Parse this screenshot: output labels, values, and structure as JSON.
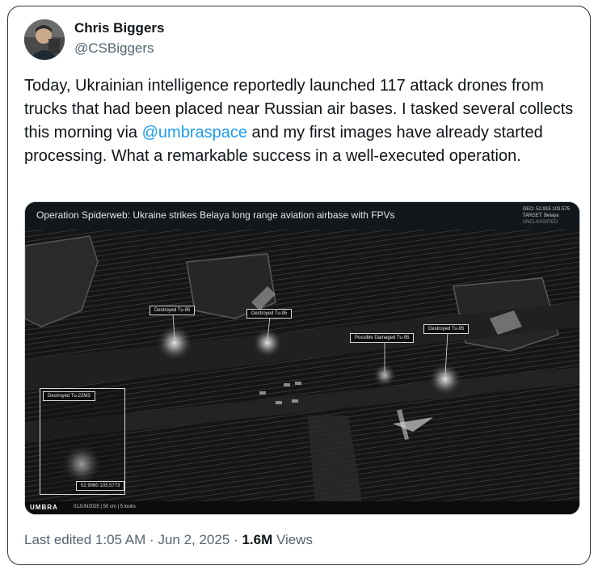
{
  "author": {
    "name": "Chris Biggers",
    "handle": "@CSBiggers"
  },
  "tweet": {
    "text_before": "Today, Ukrainian intelligence reportedly launched 117 attack drones from trucks that had been placed near Russian air bases. I tasked several collects this morning via ",
    "mention": "@umbraspace",
    "text_after": " and my first images have already started processing. What a remarkable success in a well-executed operation."
  },
  "media": {
    "title": "Operation Spiderweb: Ukraine strikes Belaya long range aviation airbase with FPVs",
    "geo_line": "GEO: 52.915 103.575",
    "target_line": "TARGET: Belaya",
    "classification": "UNCLASSIFIED",
    "labels": [
      "Destroyed Tu-95",
      "Destroyed Tu-95",
      "Possible Damaged Tu-95",
      "Destroyed Tu-95"
    ],
    "inset_label": "Destroyed Tu-22M3",
    "inset_coords": "52.9060 103.5773",
    "logo": "UMBRA",
    "footer_info": "01JUN2025 | 50 cm | 5 looks"
  },
  "meta": {
    "last_edited_label": "Last edited",
    "time": "1:05 AM",
    "separator": "·",
    "date": "Jun 2, 2025",
    "views_count": "1.6M",
    "views_label": "Views"
  },
  "icons": [
    "avatar",
    "umbra-logo-icon"
  ],
  "colors": {
    "link": "#1d9bf0",
    "secondary_text": "#536471",
    "primary_text": "#0f1419"
  }
}
